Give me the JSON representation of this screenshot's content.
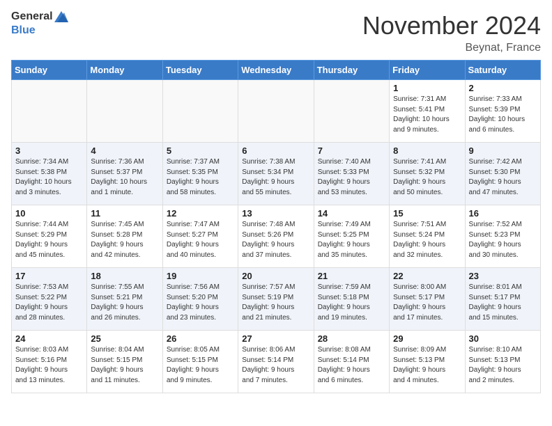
{
  "header": {
    "logo_general": "General",
    "logo_blue": "Blue",
    "month_title": "November 2024",
    "location": "Beynat, France"
  },
  "days_of_week": [
    "Sunday",
    "Monday",
    "Tuesday",
    "Wednesday",
    "Thursday",
    "Friday",
    "Saturday"
  ],
  "weeks": [
    [
      {
        "day": "",
        "info": ""
      },
      {
        "day": "",
        "info": ""
      },
      {
        "day": "",
        "info": ""
      },
      {
        "day": "",
        "info": ""
      },
      {
        "day": "",
        "info": ""
      },
      {
        "day": "1",
        "info": "Sunrise: 7:31 AM\nSunset: 5:41 PM\nDaylight: 10 hours\nand 9 minutes."
      },
      {
        "day": "2",
        "info": "Sunrise: 7:33 AM\nSunset: 5:39 PM\nDaylight: 10 hours\nand 6 minutes."
      }
    ],
    [
      {
        "day": "3",
        "info": "Sunrise: 7:34 AM\nSunset: 5:38 PM\nDaylight: 10 hours\nand 3 minutes."
      },
      {
        "day": "4",
        "info": "Sunrise: 7:36 AM\nSunset: 5:37 PM\nDaylight: 10 hours\nand 1 minute."
      },
      {
        "day": "5",
        "info": "Sunrise: 7:37 AM\nSunset: 5:35 PM\nDaylight: 9 hours\nand 58 minutes."
      },
      {
        "day": "6",
        "info": "Sunrise: 7:38 AM\nSunset: 5:34 PM\nDaylight: 9 hours\nand 55 minutes."
      },
      {
        "day": "7",
        "info": "Sunrise: 7:40 AM\nSunset: 5:33 PM\nDaylight: 9 hours\nand 53 minutes."
      },
      {
        "day": "8",
        "info": "Sunrise: 7:41 AM\nSunset: 5:32 PM\nDaylight: 9 hours\nand 50 minutes."
      },
      {
        "day": "9",
        "info": "Sunrise: 7:42 AM\nSunset: 5:30 PM\nDaylight: 9 hours\nand 47 minutes."
      }
    ],
    [
      {
        "day": "10",
        "info": "Sunrise: 7:44 AM\nSunset: 5:29 PM\nDaylight: 9 hours\nand 45 minutes."
      },
      {
        "day": "11",
        "info": "Sunrise: 7:45 AM\nSunset: 5:28 PM\nDaylight: 9 hours\nand 42 minutes."
      },
      {
        "day": "12",
        "info": "Sunrise: 7:47 AM\nSunset: 5:27 PM\nDaylight: 9 hours\nand 40 minutes."
      },
      {
        "day": "13",
        "info": "Sunrise: 7:48 AM\nSunset: 5:26 PM\nDaylight: 9 hours\nand 37 minutes."
      },
      {
        "day": "14",
        "info": "Sunrise: 7:49 AM\nSunset: 5:25 PM\nDaylight: 9 hours\nand 35 minutes."
      },
      {
        "day": "15",
        "info": "Sunrise: 7:51 AM\nSunset: 5:24 PM\nDaylight: 9 hours\nand 32 minutes."
      },
      {
        "day": "16",
        "info": "Sunrise: 7:52 AM\nSunset: 5:23 PM\nDaylight: 9 hours\nand 30 minutes."
      }
    ],
    [
      {
        "day": "17",
        "info": "Sunrise: 7:53 AM\nSunset: 5:22 PM\nDaylight: 9 hours\nand 28 minutes."
      },
      {
        "day": "18",
        "info": "Sunrise: 7:55 AM\nSunset: 5:21 PM\nDaylight: 9 hours\nand 26 minutes."
      },
      {
        "day": "19",
        "info": "Sunrise: 7:56 AM\nSunset: 5:20 PM\nDaylight: 9 hours\nand 23 minutes."
      },
      {
        "day": "20",
        "info": "Sunrise: 7:57 AM\nSunset: 5:19 PM\nDaylight: 9 hours\nand 21 minutes."
      },
      {
        "day": "21",
        "info": "Sunrise: 7:59 AM\nSunset: 5:18 PM\nDaylight: 9 hours\nand 19 minutes."
      },
      {
        "day": "22",
        "info": "Sunrise: 8:00 AM\nSunset: 5:17 PM\nDaylight: 9 hours\nand 17 minutes."
      },
      {
        "day": "23",
        "info": "Sunrise: 8:01 AM\nSunset: 5:17 PM\nDaylight: 9 hours\nand 15 minutes."
      }
    ],
    [
      {
        "day": "24",
        "info": "Sunrise: 8:03 AM\nSunset: 5:16 PM\nDaylight: 9 hours\nand 13 minutes."
      },
      {
        "day": "25",
        "info": "Sunrise: 8:04 AM\nSunset: 5:15 PM\nDaylight: 9 hours\nand 11 minutes."
      },
      {
        "day": "26",
        "info": "Sunrise: 8:05 AM\nSunset: 5:15 PM\nDaylight: 9 hours\nand 9 minutes."
      },
      {
        "day": "27",
        "info": "Sunrise: 8:06 AM\nSunset: 5:14 PM\nDaylight: 9 hours\nand 7 minutes."
      },
      {
        "day": "28",
        "info": "Sunrise: 8:08 AM\nSunset: 5:14 PM\nDaylight: 9 hours\nand 6 minutes."
      },
      {
        "day": "29",
        "info": "Sunrise: 8:09 AM\nSunset: 5:13 PM\nDaylight: 9 hours\nand 4 minutes."
      },
      {
        "day": "30",
        "info": "Sunrise: 8:10 AM\nSunset: 5:13 PM\nDaylight: 9 hours\nand 2 minutes."
      }
    ]
  ]
}
